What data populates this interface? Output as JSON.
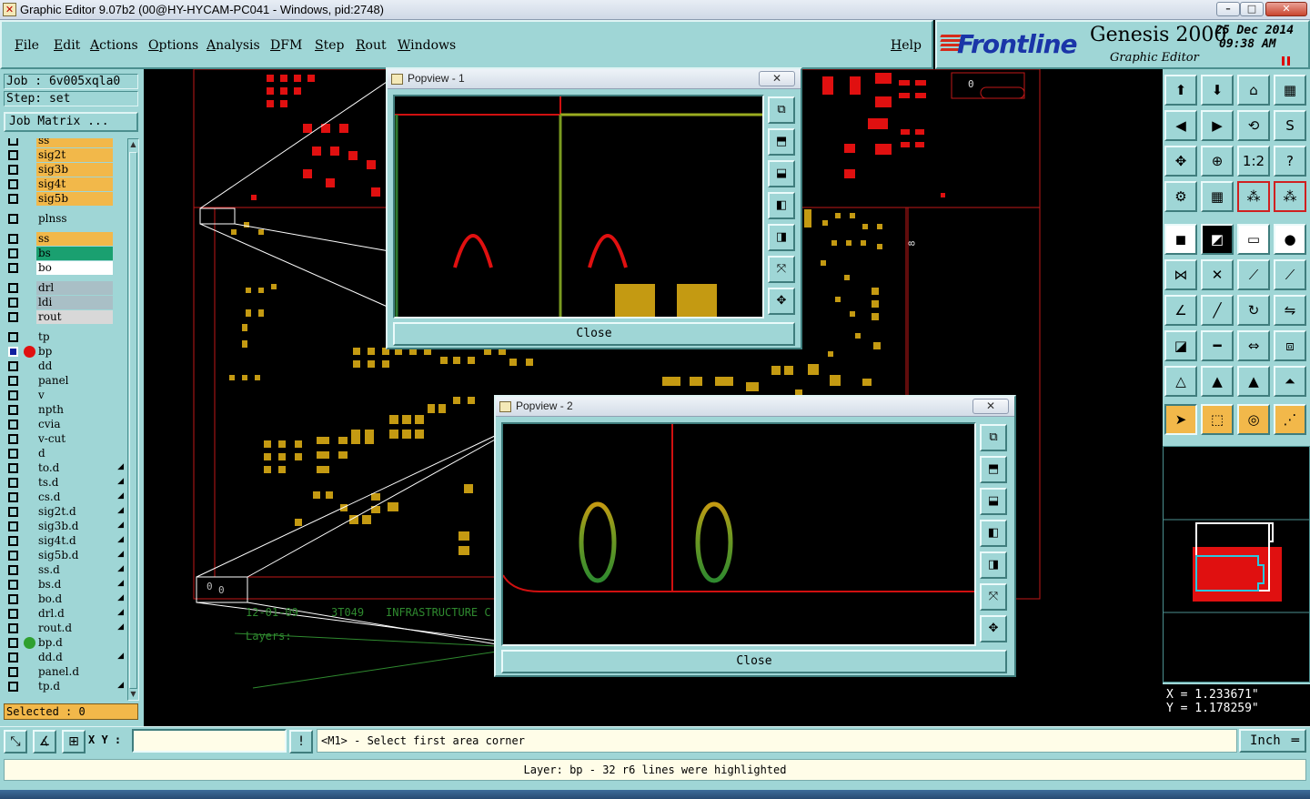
{
  "window": {
    "title": "Graphic Editor 9.07b2 (00@HY-HYCAM-PC041 - Windows, pid:2748)",
    "minimize": "–",
    "maximize": "□",
    "close": "✕"
  },
  "menu": {
    "items": [
      "File",
      "Edit",
      "Actions",
      "Options",
      "Analysis",
      "DFM",
      "Step",
      "Rout",
      "Windows"
    ],
    "help": "Help"
  },
  "brand": {
    "logo": "Frontline",
    "product": "Genesis 2000",
    "subtitle": "Graphic Editor",
    "date": "25 Dec 2014",
    "time": "09:38 AM"
  },
  "job": {
    "job_label": "Job : 6v005xqla0",
    "step_label": "Step: set",
    "matrix_button": "Job Matrix ...",
    "selected": "Selected : 0"
  },
  "layers": [
    {
      "name": "ss",
      "color": "#f2b84a"
    },
    {
      "name": "sig2t",
      "color": "#f2b84a"
    },
    {
      "name": "sig3b",
      "color": "#f2b84a"
    },
    {
      "name": "sig4t",
      "color": "#f2b84a"
    },
    {
      "name": "sig5b",
      "color": "#f2b84a"
    },
    {
      "name": "plnss",
      "color": "#9fd6d6"
    },
    {
      "name": "ss",
      "color": "#f2b84a"
    },
    {
      "name": "bs",
      "color": "#1aa070"
    },
    {
      "name": "bo",
      "color": "#ffffff"
    },
    {
      "name": "drl",
      "color": "#a9bfc6"
    },
    {
      "name": "ldi",
      "color": "#a9bfc6"
    },
    {
      "name": "rout",
      "color": "#d8d8d8"
    },
    {
      "name": "tp",
      "color": "#9fd6d6"
    },
    {
      "name": "bp",
      "color": "#9fd6d6"
    },
    {
      "name": "dd",
      "color": "#9fd6d6"
    },
    {
      "name": "panel",
      "color": "#9fd6d6"
    },
    {
      "name": "v",
      "color": "#9fd6d6"
    },
    {
      "name": "npth",
      "color": "#9fd6d6"
    },
    {
      "name": "cvia",
      "color": "#9fd6d6"
    },
    {
      "name": "v-cut",
      "color": "#9fd6d6"
    },
    {
      "name": "d",
      "color": "#9fd6d6"
    },
    {
      "name": "to.d",
      "color": "#9fd6d6"
    },
    {
      "name": "ts.d",
      "color": "#9fd6d6"
    },
    {
      "name": "cs.d",
      "color": "#9fd6d6"
    },
    {
      "name": "sig2t.d",
      "color": "#9fd6d6"
    },
    {
      "name": "sig3b.d",
      "color": "#9fd6d6"
    },
    {
      "name": "sig4t.d",
      "color": "#9fd6d6"
    },
    {
      "name": "sig5b.d",
      "color": "#9fd6d6"
    },
    {
      "name": "ss.d",
      "color": "#9fd6d6"
    },
    {
      "name": "bs.d",
      "color": "#9fd6d6"
    },
    {
      "name": "bo.d",
      "color": "#9fd6d6"
    },
    {
      "name": "drl.d",
      "color": "#9fd6d6"
    },
    {
      "name": "rout.d",
      "color": "#9fd6d6"
    },
    {
      "name": "bp.d",
      "color": "#9fd6d6"
    },
    {
      "name": "dd.d",
      "color": "#9fd6d6"
    },
    {
      "name": "panel.d",
      "color": "#9fd6d6"
    },
    {
      "name": "tp.d",
      "color": "#9fd6d6"
    }
  ],
  "canvas_text": {
    "zero_a": "0",
    "zero_b": "0",
    "zero_c": "0",
    "eight": "8",
    "date_line": "12-01-09",
    "code": "3T049",
    "company": "INFRASTRUCTURE C",
    "layers": "Layers:"
  },
  "popview1": {
    "title": "Popview - 1",
    "close": "Close",
    "close_x": "✕"
  },
  "popview2": {
    "title": "Popview - 2",
    "close": "Close",
    "close_x": "✕"
  },
  "right_tools": {
    "scale_label": "1:2",
    "help_label": "?"
  },
  "coords": {
    "x": "X = 1.233671\"",
    "y": "Y = 1.178259\""
  },
  "bottom": {
    "xy_label": "X Y :",
    "xy_value": "",
    "prompt": "<M1> - Select first area corner",
    "units": "Inch",
    "status": "Layer: bp - 32 r6 lines were highlighted"
  }
}
